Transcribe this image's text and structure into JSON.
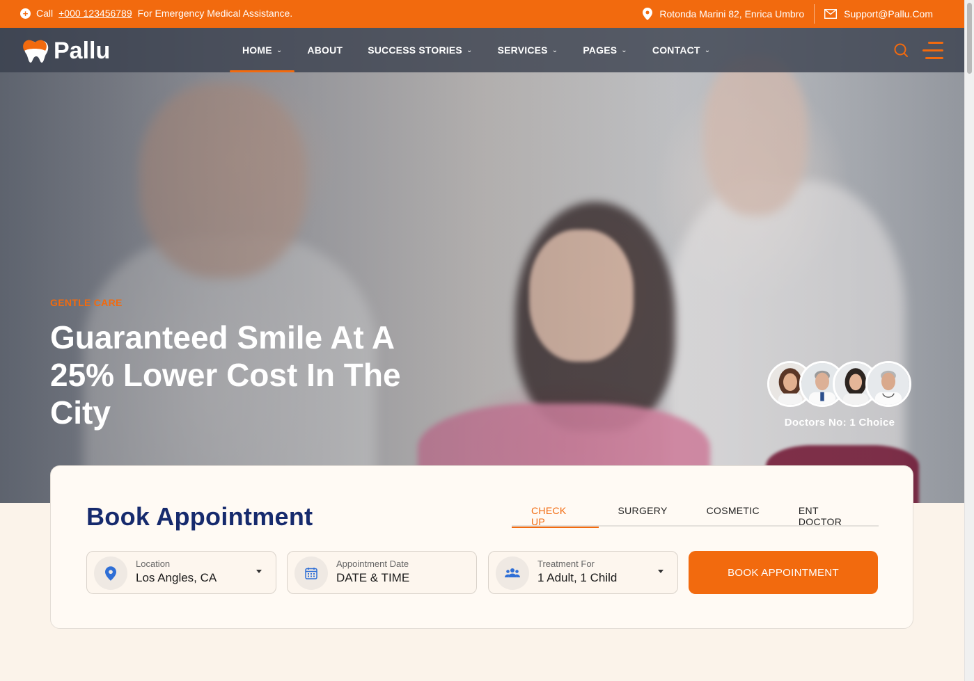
{
  "topbar": {
    "call_prefix": "Call",
    "phone": "+000 123456789",
    "call_suffix": "For Emergency Medical Assistance.",
    "address": "Rotonda Marini 82, Enrica Umbro",
    "email": "Support@Pallu.Com"
  },
  "brand": {
    "name": "Pallu"
  },
  "nav": {
    "items": [
      {
        "label": "HOME",
        "has_dropdown": true,
        "active": true
      },
      {
        "label": "ABOUT",
        "has_dropdown": false
      },
      {
        "label": "SUCCESS STORIES",
        "has_dropdown": true
      },
      {
        "label": "SERVICES",
        "has_dropdown": true
      },
      {
        "label": "PAGES",
        "has_dropdown": true
      },
      {
        "label": "CONTACT",
        "has_dropdown": true
      }
    ]
  },
  "hero": {
    "eyebrow": "GENTLE CARE",
    "headline": "Guaranteed Smile At A 25% Lower Cost In The City",
    "doctors_label": "Doctors No: 1 Choice"
  },
  "booking": {
    "title": "Book Appointment",
    "tabs": [
      "CHECK UP",
      "SURGERY",
      "COSMETIC",
      "ENT DOCTOR"
    ],
    "active_tab": "CHECK UP",
    "location": {
      "label": "Location",
      "value": "Los Angles, CA"
    },
    "date": {
      "label": "Appointment Date",
      "value": "DATE & TIME"
    },
    "treatment": {
      "label": "Treatment For",
      "value": "1 Adult, 1 Child"
    },
    "button": "BOOK APPOINTMENT"
  },
  "colors": {
    "accent": "#f26a0e",
    "navy": "#162a6d",
    "cream": "#fbf3ea"
  },
  "icons": [
    "plus-circle-icon",
    "map-pin-icon",
    "mail-icon",
    "tooth-logo-icon",
    "search-icon",
    "menu-icon",
    "location-pin-icon",
    "calendar-icon",
    "users-icon"
  ]
}
